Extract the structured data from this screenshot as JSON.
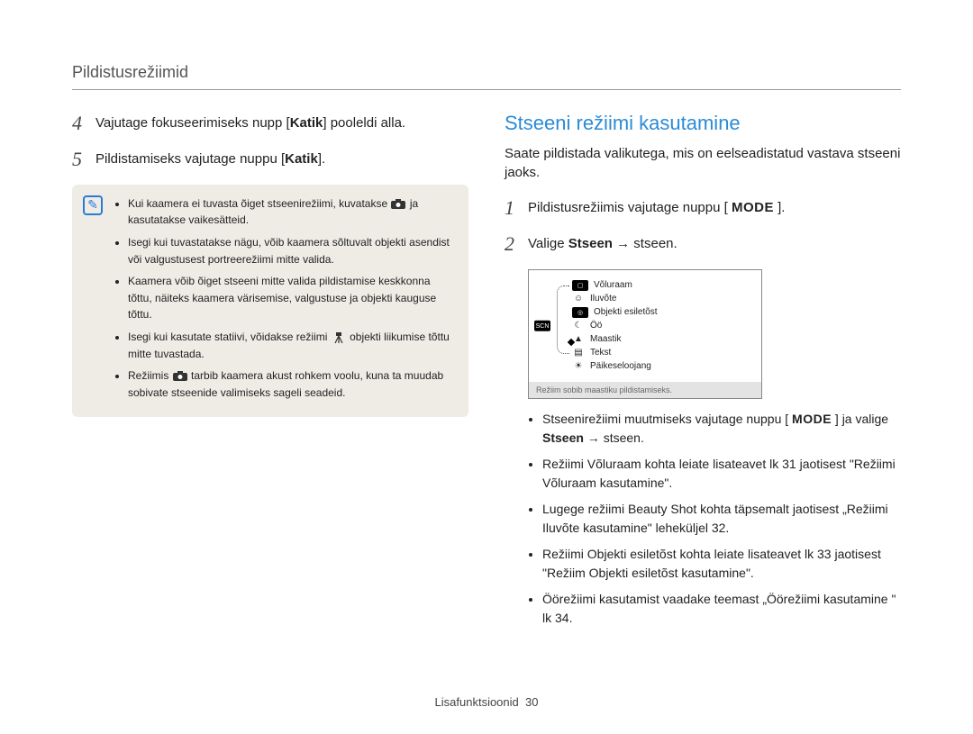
{
  "header": {
    "title": "Pildistusrežiimid"
  },
  "left": {
    "steps": [
      {
        "num": "4",
        "pre": "Vajutage fokuseerimiseks nupp [",
        "bold": "Katik",
        "post": "] pooleldi alla."
      },
      {
        "num": "5",
        "pre": "Pildistamiseks vajutage nuppu [",
        "bold": "Katik",
        "post": "]."
      }
    ],
    "note_icon": "✎",
    "notes": {
      "n1a": "Kui kaamera ei tuvasta õiget stseenirežiimi, kuvatakse ",
      "n1b": " ja kasutatakse vaikesätteid.",
      "n2": "Isegi kui tuvastatakse nägu, võib kaamera sõltuvalt objekti asendist või valgustusest portreerežiimi mitte valida.",
      "n3": "Kaamera võib õiget stseeni mitte valida pildistamise keskkonna tõttu, näiteks kaamera värisemise, valgustuse ja objekti kauguse tõttu.",
      "n4a": "Isegi kui kasutate statiivi, võidakse režiimi ",
      "n4b": " objekti liikumise tõttu mitte tuvastada.",
      "n5a": "Režiimis ",
      "n5b": " tarbib kaamera akust rohkem voolu, kuna ta muudab sobivate stseenide valimiseks sageli seadeid."
    },
    "icon_smart": "smart-auto-icon",
    "icon_tripod": "tripod-icon"
  },
  "right": {
    "section_title": "Stseeni režiimi kasutamine",
    "intro": "Saate pildistada valikutega, mis on eelseadistatud vastava stseeni jaoks.",
    "steps": {
      "s1": {
        "num": "1",
        "pre": "Pildistusrežiimis vajutage nuppu [ ",
        "bold": "MODE",
        "post": " ]."
      },
      "s2": {
        "num": "2",
        "pre": "Valige ",
        "bold": "Stseen",
        "post": " → stseen."
      }
    },
    "screen": {
      "items": [
        {
          "icon": "frame-icon",
          "label": "Võluraam",
          "boxed": true
        },
        {
          "icon": "face-icon",
          "label": "Iluvõte"
        },
        {
          "icon": "highlight-icon",
          "label": "Objekti esiletõst",
          "boxed": true
        },
        {
          "icon": "night-icon",
          "label": "Öö"
        },
        {
          "icon": "landscape-icon",
          "label": "Maastik",
          "selected": true
        },
        {
          "icon": "text-icon",
          "label": "Tekst"
        },
        {
          "icon": "sunset-icon",
          "label": "Päikeseloojang"
        }
      ],
      "side_icon": "scene-mode-icon",
      "footer": "Režiim sobib maastiku pildistamiseks."
    },
    "bullets": {
      "b1a": "Stseenirežiimi muutmiseks vajutage nuppu [ ",
      "b1b": "MODE",
      "b1c": " ] ja valige ",
      "b1d": "Stseen",
      "b1e": " → stseen.",
      "b2": "Režiimi Võluraam kohta leiate lisateavet lk 31 jaotisest \"Režiimi Võluraam kasutamine\".",
      "b3": "Lugege režiimi Beauty Shot kohta täpsemalt jaotisest „Režiimi Iluvõte kasutamine\" leheküljel 32.",
      "b4": "Režiimi Objekti esiletõst kohta leiate lisateavet lk 33 jaotisest \"Režiim Objekti esiletõst kasutamine\".",
      "b5": "Öörežiimi kasutamist vaadake teemast „Öörežiimi kasutamine \" lk 34."
    }
  },
  "footer": {
    "section": "Lisafunktsioonid",
    "page": "30"
  }
}
